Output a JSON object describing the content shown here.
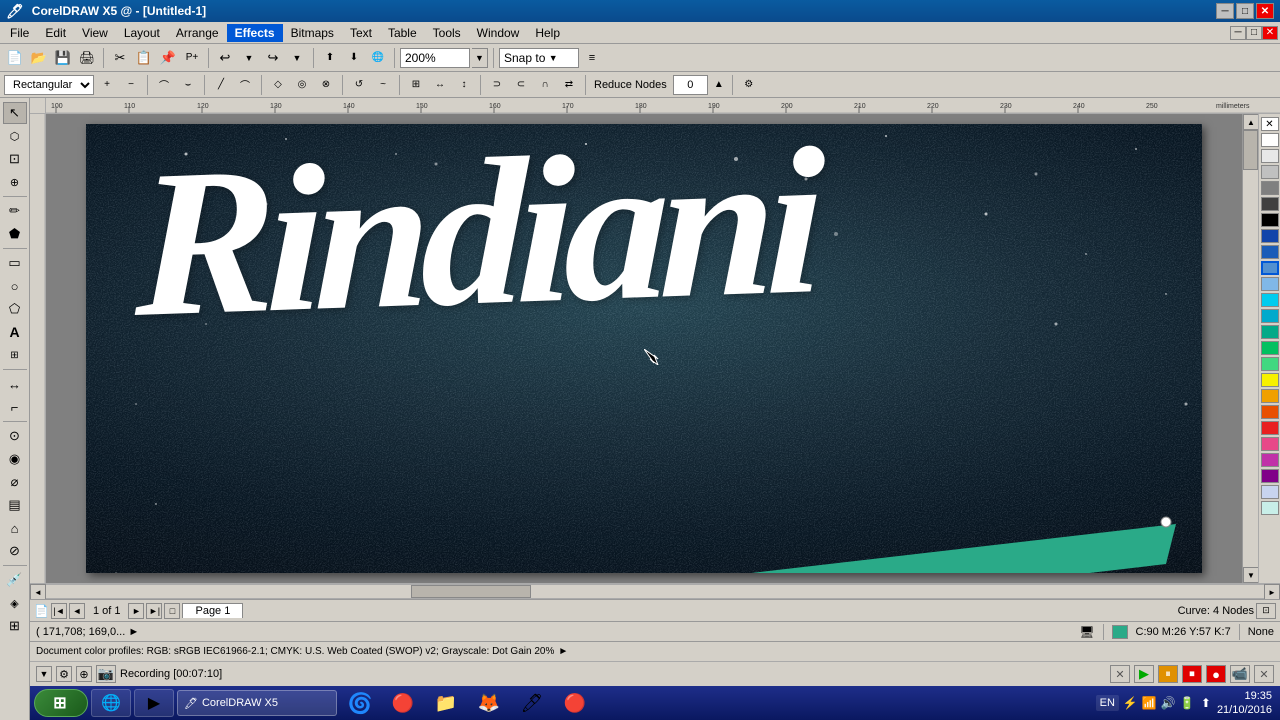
{
  "titlebar": {
    "title": "CorelDRAW X5 @ - [Untitled-1]",
    "min_btn": "─",
    "max_btn": "□",
    "close_btn": "✕",
    "inner_min": "─",
    "inner_max": "□",
    "inner_close": "✕"
  },
  "menubar": {
    "items": [
      "File",
      "Edit",
      "View",
      "Layout",
      "Arrange",
      "Effects",
      "Bitmaps",
      "Text",
      "Table",
      "Tools",
      "Window",
      "Help"
    ]
  },
  "toolbar1": {
    "zoom_value": "200%",
    "zoom_dropdown": "▼",
    "snap_to": "Snap to",
    "snap_dropdown": "▼"
  },
  "toolbar2": {
    "shape_type": "Rectangular",
    "reduce_nodes_label": "Reduce Nodes",
    "reduce_nodes_value": "0"
  },
  "canvas": {
    "text": "Rindiani",
    "page_label": "Page 1"
  },
  "statusbar": {
    "page_info": "1 of 1",
    "page_name": "Page 1"
  },
  "infobar": {
    "coordinates": "( 171,708; 169,0...  ►",
    "node_info": "Curve: 4 Nodes",
    "arrow": "►"
  },
  "colorinfobar": {
    "color_model": "Document color profiles: RGB: sRGB IEC61966-2.1; CMYK: U.S. Web Coated (SWOP) v2; Grayscale: Dot Gain 20%",
    "arrow": "►",
    "color_value": "C:90 M:26 Y:57 K:7",
    "fill_label": "None"
  },
  "recordingbar": {
    "recording_text": "Recording [00:07:10]",
    "stop_color": "#e00000",
    "pause_color": "#e09000"
  },
  "taskbar": {
    "time": "19:35",
    "date": "21/10/2016",
    "start_icon": "⊞"
  },
  "palette": {
    "colors": [
      "#1a1a8a",
      "#1a5cb8",
      "#4a9ade",
      "#7ac4e8",
      "#a8dff0",
      "#00a86b",
      "#00c87a",
      "#3de88a",
      "#e8e800",
      "#f0b000",
      "#e86000",
      "#e83000",
      "#e85880",
      "#c030a8",
      "#800080",
      "#400080",
      "#000000",
      "#404040",
      "#808080",
      "#c0c0c0",
      "#ffffff",
      "#40c0a0",
      "#008060"
    ]
  },
  "icons": {
    "arrow_tool": "↖",
    "node_tool": "⬡",
    "crop_tool": "⊡",
    "zoom_tool": "🔍",
    "freehand": "✏",
    "pen_tool": "🖊",
    "text_tool": "A",
    "shape_tool": "◻",
    "fill_tool": "🪣",
    "eyedropper": "💉",
    "outline_tool": "○",
    "transform": "⟲"
  }
}
